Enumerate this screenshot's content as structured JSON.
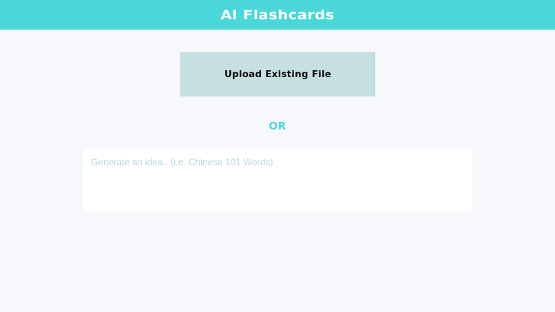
{
  "header": {
    "title": "AI Flashcards",
    "background_color": "#49d7da"
  },
  "main": {
    "upload_button_label": "Upload Existing File",
    "or_separator": "OR",
    "idea_input": {
      "placeholder": "Generate an idea.. (i.e. Chinese 101 Words)",
      "value": ""
    }
  },
  "colors": {
    "accent": "#49d7da",
    "upload_button_bg": "#c6e0e2",
    "page_bg": "#f6f8fc"
  }
}
